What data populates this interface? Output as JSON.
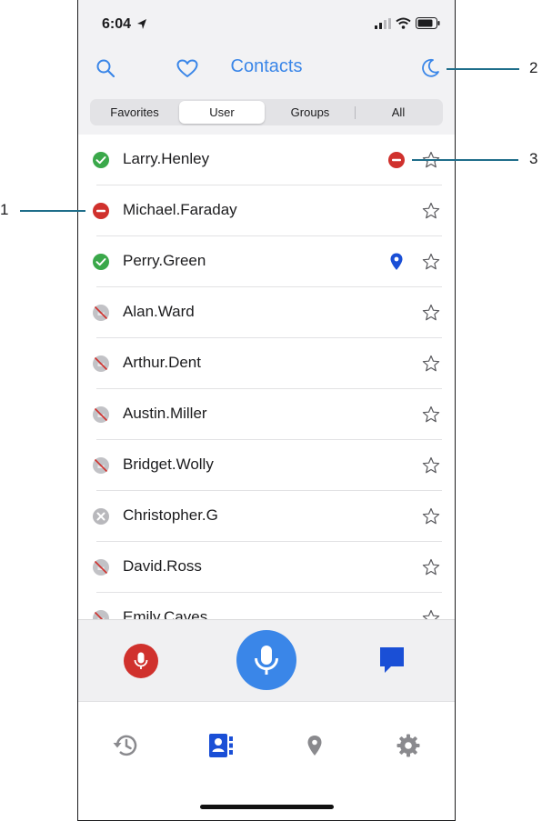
{
  "status_bar": {
    "time": "6:04"
  },
  "header": {
    "title": "Contacts"
  },
  "segments": [
    "Favorites",
    "User",
    "Groups",
    "All"
  ],
  "selected_segment": "User",
  "contacts": [
    {
      "name": "Larry.Henley",
      "status": "available",
      "extra": "dnd-icon"
    },
    {
      "name": "Michael.Faraday",
      "status": "do-not-disturb",
      "extra": ""
    },
    {
      "name": "Perry.Green",
      "status": "available",
      "extra": "location-pin-icon"
    },
    {
      "name": "Alan.Ward",
      "status": "offline",
      "extra": ""
    },
    {
      "name": "Arthur.Dent",
      "status": "offline",
      "extra": ""
    },
    {
      "name": "Austin.Miller",
      "status": "offline",
      "extra": ""
    },
    {
      "name": "Bridget.Wolly",
      "status": "offline",
      "extra": ""
    },
    {
      "name": "Christopher.G",
      "status": "unavailable",
      "extra": ""
    },
    {
      "name": "David.Ross",
      "status": "offline",
      "extra": ""
    },
    {
      "name": "Emily.Caves",
      "status": "offline",
      "extra": ""
    }
  ],
  "tabs": [
    "history-icon",
    "contacts-icon",
    "map-icon",
    "settings-icon"
  ],
  "active_tab": "contacts-icon",
  "callouts": [
    "1",
    "2",
    "3"
  ],
  "colors": {
    "accent": "#3a86e8",
    "available": "#3aa84a",
    "dnd": "#d0312d",
    "offline": "#b8b8bc",
    "ptt": "#3a86e8"
  }
}
